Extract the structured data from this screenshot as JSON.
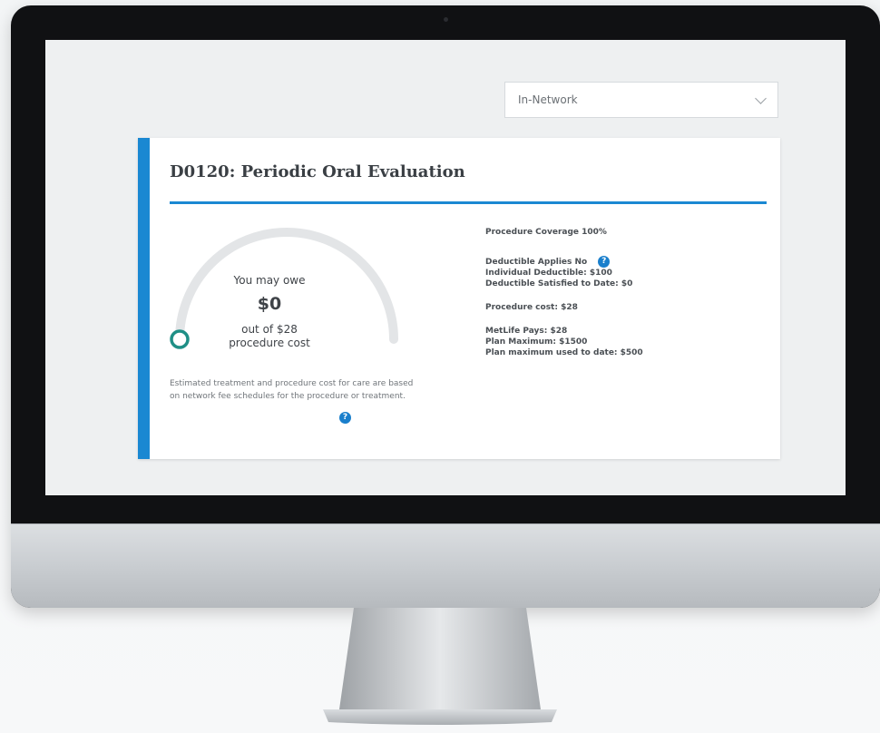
{
  "network_select": {
    "selected": "In-Network"
  },
  "card": {
    "title": "D0120: Periodic Oral Evaluation",
    "gauge": {
      "you_may_owe_label": "You may owe",
      "amount": "$0",
      "out_of_line1": "out of $28",
      "out_of_line2": "procedure cost",
      "owed_fraction": 0
    },
    "disclaimer": "Estimated treatment and procedure cost for care are based on network fee schedules for the procedure or treatment.",
    "details": {
      "procedure_coverage": "Procedure Coverage 100%",
      "deductible_applies": "Deductible Applies No",
      "individual_deductible": "Individual Deductible: $100",
      "deductible_satisfied": "Deductible Satisfied to Date: $0",
      "procedure_cost": "Procedure cost: $28",
      "metlife_pays": "MetLife Pays: $28",
      "plan_maximum": "Plan Maximum: $1500",
      "plan_maximum_used": "Plan maximum used to date: $500"
    }
  },
  "colors": {
    "accent": "#1a88d2",
    "gauge_track": "#e3e5e7",
    "gauge_marker": "#1f8f86"
  }
}
